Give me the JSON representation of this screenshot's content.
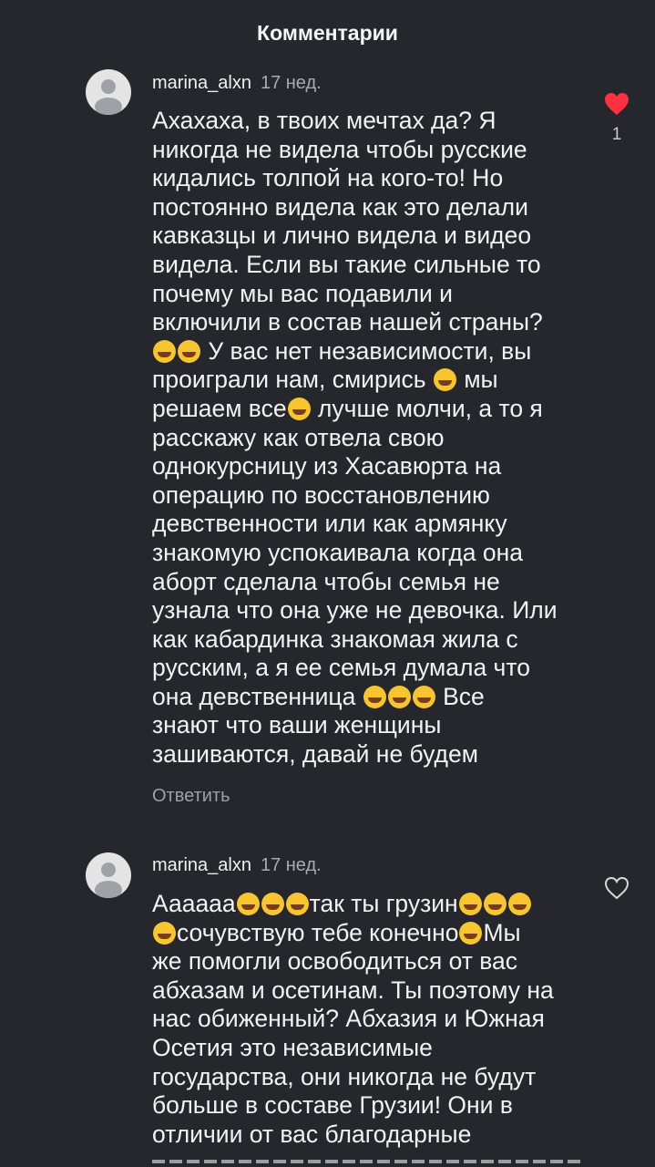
{
  "header": {
    "title": "Комментарии"
  },
  "comments": [
    {
      "username": "marina_alxn",
      "time": "17 нед.",
      "lines": [
        [
          "Ахахаха, в твоих мечтах да? Я"
        ],
        [
          "никогда не видела чтобы русские"
        ],
        [
          "кидались толпой на кого-то! Но"
        ],
        [
          "постоянно видела как это делали"
        ],
        [
          "кавказцы и лично видела и видео"
        ],
        [
          "видела. Если вы такие сильные то"
        ],
        [
          "почему мы вас подавили и"
        ],
        [
          "включили в состав нашей страны?"
        ],
        [
          "🤣🤣",
          " У вас нет независимости, вы"
        ],
        [
          "проиграли нам, смирись ",
          "😘",
          " мы"
        ],
        [
          "решаем все",
          "😉",
          " лучше молчи, а то я"
        ],
        [
          "расскажу как отвела свою"
        ],
        [
          "однокурсницу из Хасавюрта на"
        ],
        [
          "операцию по восстановлению"
        ],
        [
          "девственности или как армянку"
        ],
        [
          "знакомую успокаивала когда она"
        ],
        [
          "аборт сделала чтобы семья не"
        ],
        [
          "узнала что она уже не девочка. Или"
        ],
        [
          "как кабардинка знакомая жила с"
        ],
        [
          "русским, а я ее семья думала что"
        ],
        [
          "она девственница ",
          "🤣🤣🤣",
          " Все"
        ],
        [
          "знают что ваши женщины"
        ],
        [
          "зашиваются, давай не будем"
        ]
      ],
      "reply_label": "Ответить",
      "like_icon": "heart-filled-icon",
      "like_count": "1",
      "like_color": "#ff3040"
    },
    {
      "username": "marina_alxn",
      "time": "17 нед.",
      "lines": [
        [
          "Аааааа",
          "🤣🤣🤣",
          "так ты грузин",
          "🤣🤣🤣"
        ],
        [
          "🤣",
          "сочувствую тебе конечно",
          "🥺",
          "Мы"
        ],
        [
          "же помогли освободиться от вас"
        ],
        [
          "абхазам и осетинам. Ты поэтому на"
        ],
        [
          "нас обиженный? Абхазия и Южная"
        ],
        [
          "Осетия это независимые"
        ],
        [
          "государства, они никогда не будут"
        ],
        [
          "больше в составе Грузии! Они в"
        ],
        [
          "отличии от вас благодарные"
        ]
      ],
      "like_icon": "heart-outline-icon"
    }
  ]
}
